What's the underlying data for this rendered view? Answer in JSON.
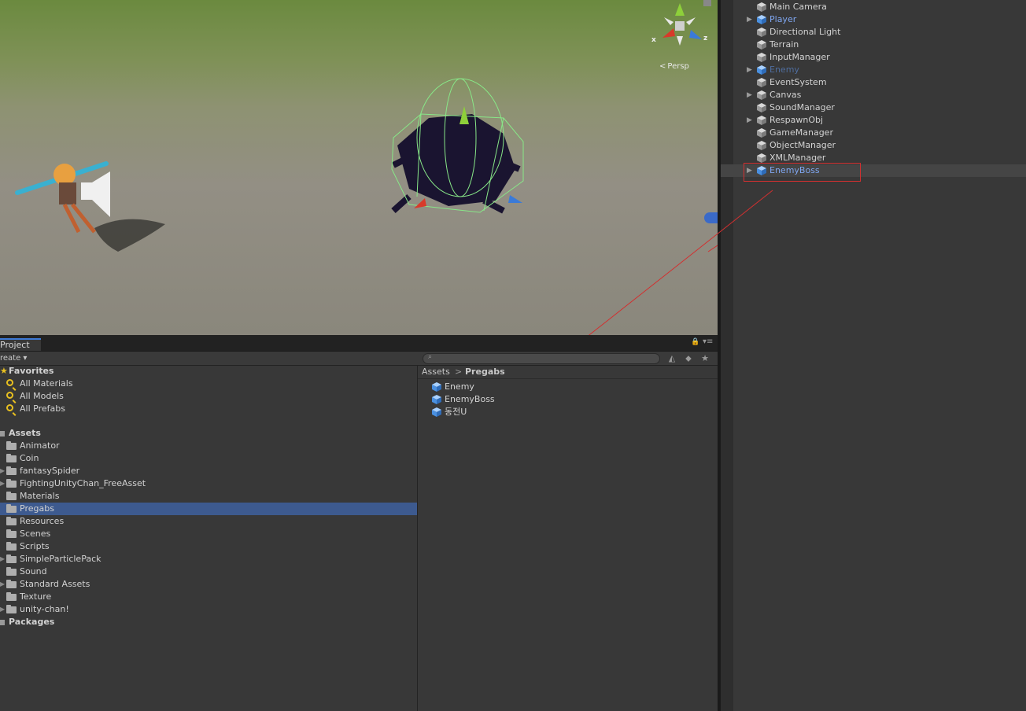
{
  "scene_view": {
    "gizmo": {
      "x_label": "x",
      "z_label": "z",
      "projection_label": "Persp"
    }
  },
  "hierarchy": {
    "items": [
      {
        "label": "Main Camera",
        "expandable": false,
        "kind": "normal"
      },
      {
        "label": "Player",
        "expandable": true,
        "kind": "prefab"
      },
      {
        "label": "Directional Light",
        "expandable": false,
        "kind": "normal"
      },
      {
        "label": "Terrain",
        "expandable": false,
        "kind": "normal"
      },
      {
        "label": "InputManager",
        "expandable": false,
        "kind": "normal"
      },
      {
        "label": "Enemy",
        "expandable": true,
        "kind": "prefab-dim"
      },
      {
        "label": "EventSystem",
        "expandable": false,
        "kind": "normal"
      },
      {
        "label": "Canvas",
        "expandable": true,
        "kind": "normal"
      },
      {
        "label": "SoundManager",
        "expandable": false,
        "kind": "normal"
      },
      {
        "label": "RespawnObj",
        "expandable": true,
        "kind": "normal"
      },
      {
        "label": "GameManager",
        "expandable": false,
        "kind": "normal"
      },
      {
        "label": "ObjectManager",
        "expandable": false,
        "kind": "normal"
      },
      {
        "label": "XMLManager",
        "expandable": false,
        "kind": "normal"
      },
      {
        "label": "EnemyBoss",
        "expandable": true,
        "kind": "prefab",
        "selected": true
      }
    ]
  },
  "project": {
    "tab_label": "Project",
    "create_label": "reate ▾",
    "favorites": {
      "title": "Favorites",
      "items": [
        "All Materials",
        "All Models",
        "All Prefabs"
      ]
    },
    "assets": {
      "title": "Assets",
      "folders": [
        {
          "label": "Animator",
          "expandable": false
        },
        {
          "label": "Coin",
          "expandable": false
        },
        {
          "label": "fantasySpider",
          "expandable": true
        },
        {
          "label": "FightingUnityChan_FreeAsset",
          "expandable": true
        },
        {
          "label": "Materials",
          "expandable": false
        },
        {
          "label": "Pregabs",
          "expandable": false,
          "selected": true
        },
        {
          "label": "Resources",
          "expandable": false
        },
        {
          "label": "Scenes",
          "expandable": false
        },
        {
          "label": "Scripts",
          "expandable": false
        },
        {
          "label": "SimpleParticlePack",
          "expandable": true
        },
        {
          "label": "Sound",
          "expandable": false
        },
        {
          "label": "Standard Assets",
          "expandable": true
        },
        {
          "label": "Texture",
          "expandable": false
        },
        {
          "label": "unity-chan!",
          "expandable": true
        }
      ]
    },
    "packages": {
      "title": "Packages"
    },
    "breadcrumb": {
      "root": "Assets",
      "separator": ">",
      "current": "Pregabs"
    },
    "files": [
      "Enemy",
      "EnemyBoss",
      "동전U"
    ]
  },
  "colors": {
    "selection_blue": "#3d5a8f",
    "prefab_blue": "#7fa6f0",
    "annotation_red": "#d23030",
    "gizmo_y": "#8ed03a",
    "gizmo_x": "#d83a2a",
    "gizmo_z": "#3a7ad8"
  },
  "icons": {
    "hierarchy_object": "gameobject-cube-icon",
    "prefab": "prefab-cube-icon",
    "folder": "folder-icon",
    "favorite_search": "magnifier-icon",
    "favorites_header": "star-icon",
    "search": "search-icon",
    "lock": "lock-icon",
    "menu": "menu-icon"
  }
}
